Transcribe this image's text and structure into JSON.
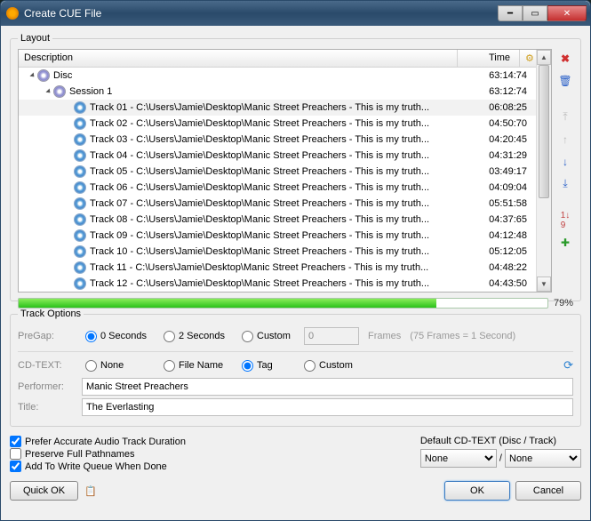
{
  "window": {
    "title": "Create CUE File"
  },
  "layout": {
    "legend": "Layout",
    "columns": {
      "description": "Description",
      "time": "Time"
    },
    "disc": {
      "label": "Disc",
      "time": "63:14:74"
    },
    "session": {
      "label": "Session 1",
      "time": "63:12:74"
    },
    "tracks": [
      {
        "label": "Track 01 - C:\\Users\\Jamie\\Desktop\\Manic Street Preachers - This is my truth...",
        "time": "06:08:25"
      },
      {
        "label": "Track 02 - C:\\Users\\Jamie\\Desktop\\Manic Street Preachers - This is my truth...",
        "time": "04:50:70"
      },
      {
        "label": "Track 03 - C:\\Users\\Jamie\\Desktop\\Manic Street Preachers - This is my truth...",
        "time": "04:20:45"
      },
      {
        "label": "Track 04 - C:\\Users\\Jamie\\Desktop\\Manic Street Preachers - This is my truth...",
        "time": "04:31:29"
      },
      {
        "label": "Track 05 - C:\\Users\\Jamie\\Desktop\\Manic Street Preachers - This is my truth...",
        "time": "03:49:17"
      },
      {
        "label": "Track 06 - C:\\Users\\Jamie\\Desktop\\Manic Street Preachers - This is my truth...",
        "time": "04:09:04"
      },
      {
        "label": "Track 07 - C:\\Users\\Jamie\\Desktop\\Manic Street Preachers - This is my truth...",
        "time": "05:51:58"
      },
      {
        "label": "Track 08 - C:\\Users\\Jamie\\Desktop\\Manic Street Preachers - This is my truth...",
        "time": "04:37:65"
      },
      {
        "label": "Track 09 - C:\\Users\\Jamie\\Desktop\\Manic Street Preachers - This is my truth...",
        "time": "04:12:48"
      },
      {
        "label": "Track 10 - C:\\Users\\Jamie\\Desktop\\Manic Street Preachers - This is my truth...",
        "time": "05:12:05"
      },
      {
        "label": "Track 11 - C:\\Users\\Jamie\\Desktop\\Manic Street Preachers - This is my truth...",
        "time": "04:48:22"
      },
      {
        "label": "Track 12 - C:\\Users\\Jamie\\Desktop\\Manic Street Preachers - This is my truth...",
        "time": "04:43:50"
      }
    ],
    "progress_pct": "79%"
  },
  "track_options": {
    "legend": "Track Options",
    "pregap_label": "PreGap:",
    "pregap_0": "0 Seconds",
    "pregap_2": "2 Seconds",
    "pregap_custom": "Custom",
    "pregap_value": "0",
    "frames_label": "Frames",
    "frames_hint": "(75 Frames = 1 Second)",
    "cdtext_label": "CD-TEXT:",
    "cdtext_none": "None",
    "cdtext_filename": "File Name",
    "cdtext_tag": "Tag",
    "cdtext_custom": "Custom",
    "performer_label": "Performer:",
    "performer_value": "Manic Street Preachers",
    "title_label": "Title:",
    "title_value": "The Everlasting"
  },
  "checks": {
    "accurate": "Prefer Accurate Audio Track Duration",
    "preserve": "Preserve Full Pathnames",
    "addqueue": "Add To Write Queue When Done"
  },
  "default_cdtext": {
    "title": "Default CD-TEXT (Disc / Track)",
    "slash": "/",
    "none": "None"
  },
  "footer": {
    "quick_ok": "Quick OK",
    "ok": "OK",
    "cancel": "Cancel"
  }
}
